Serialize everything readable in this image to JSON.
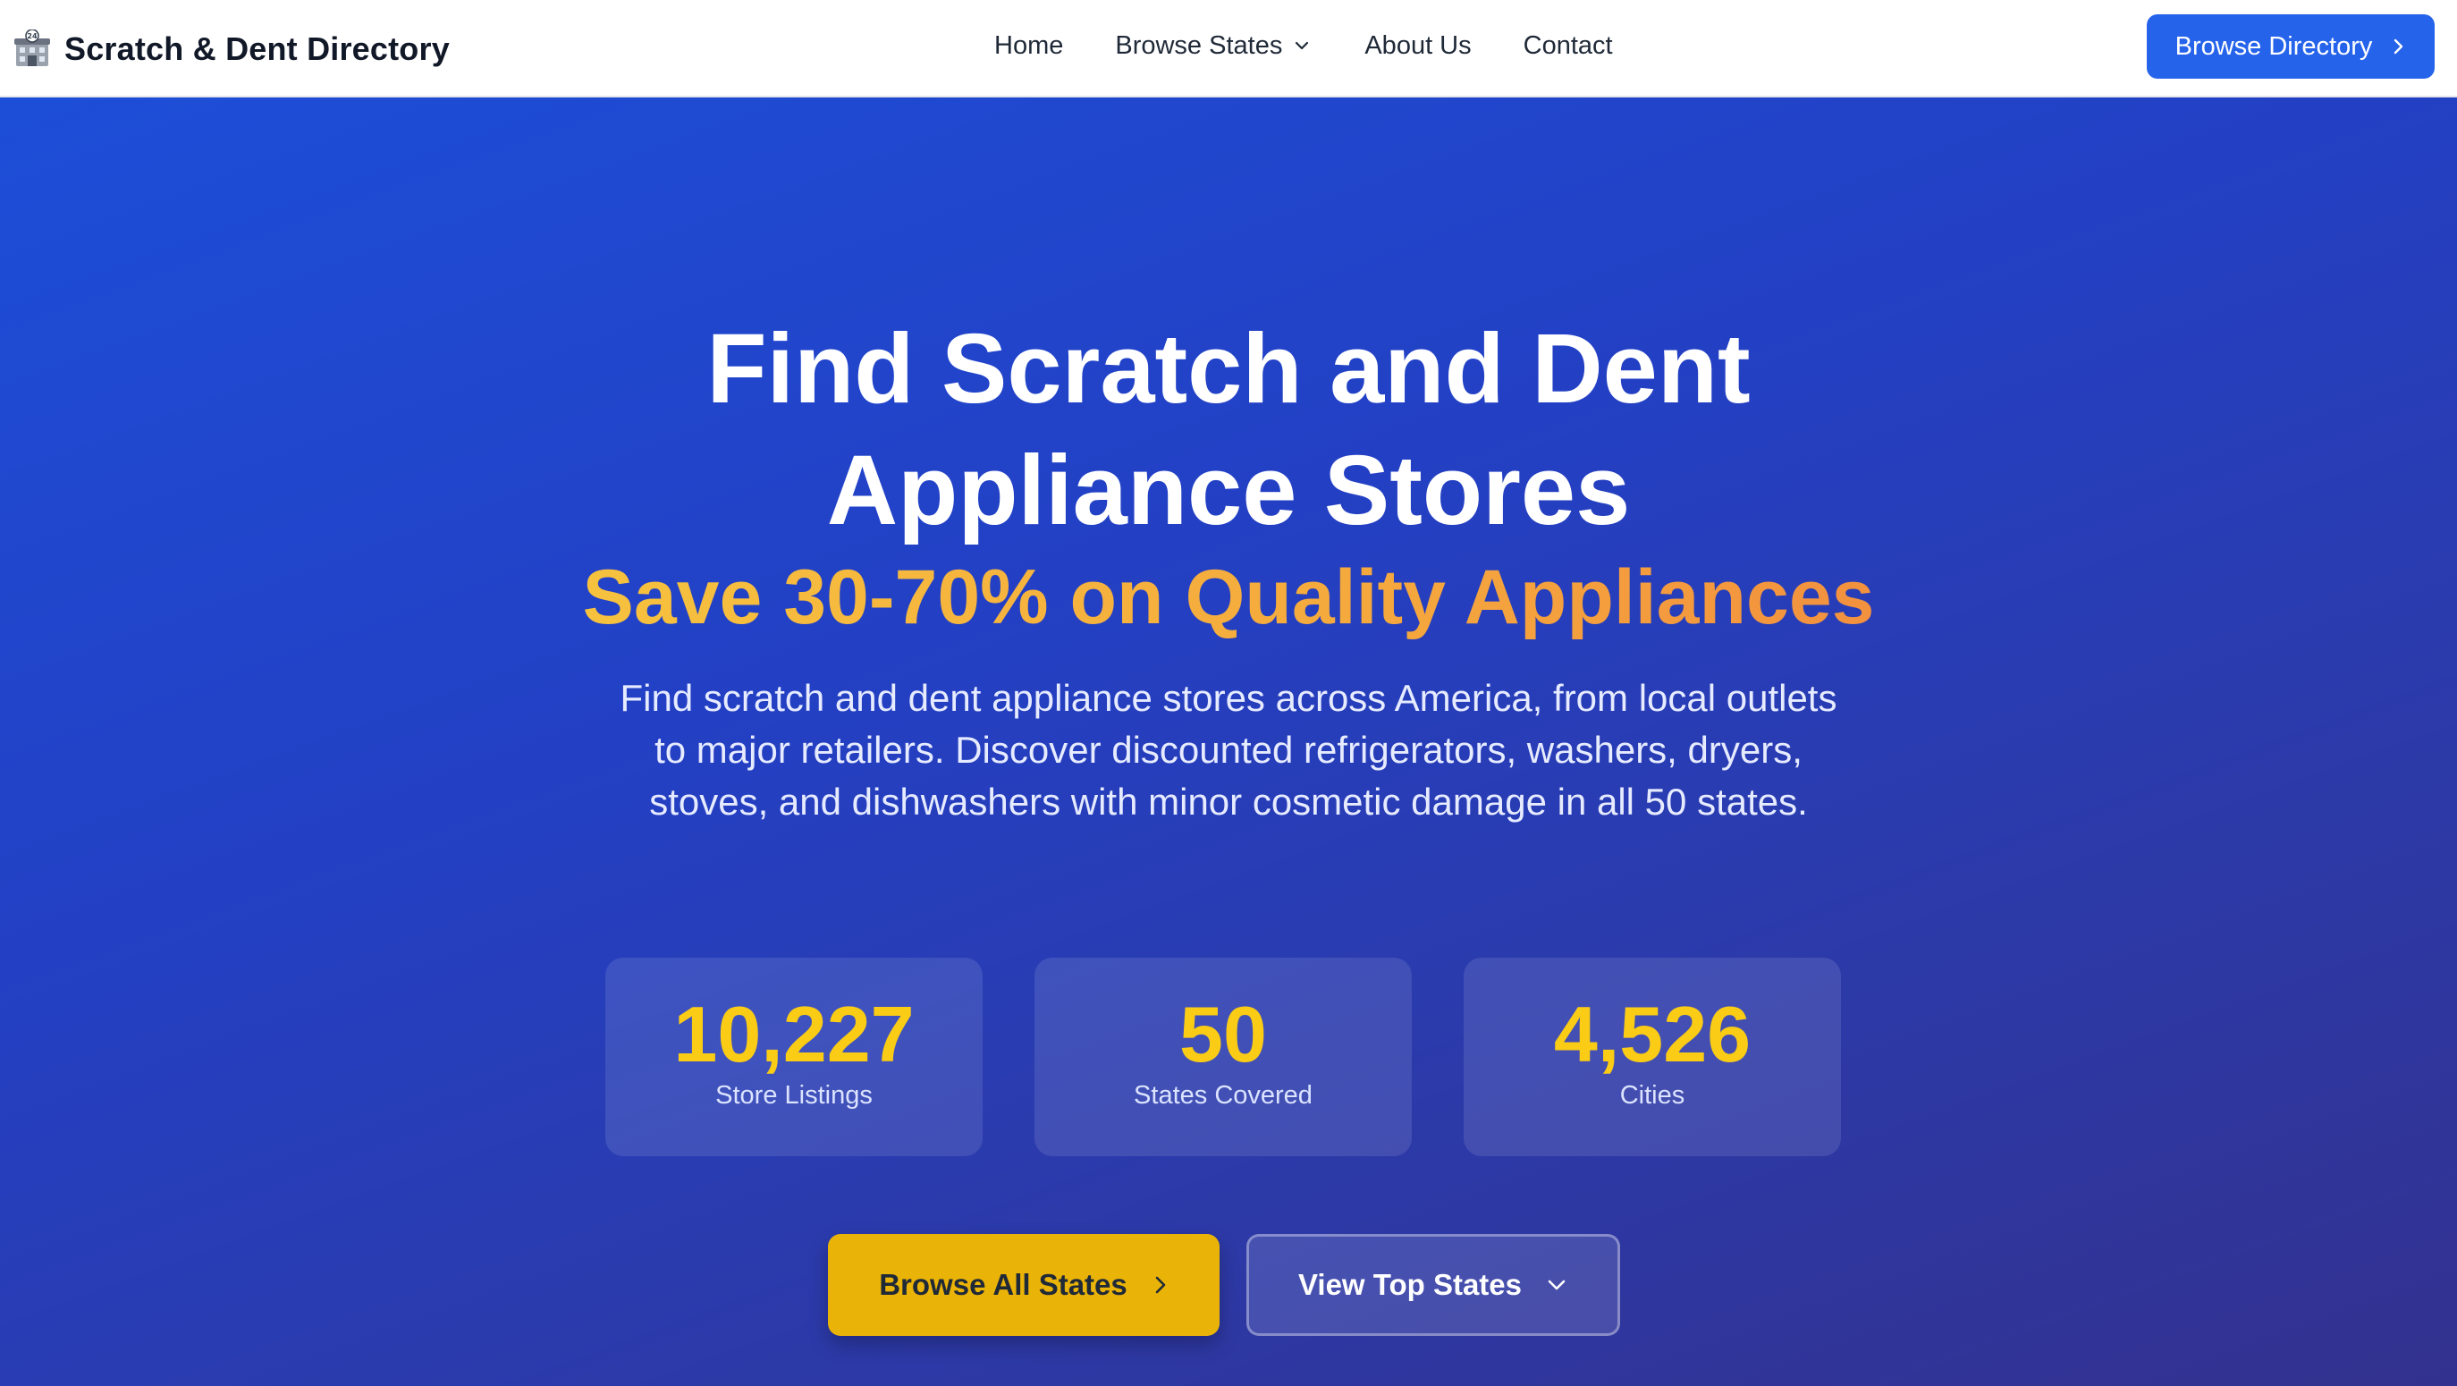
{
  "header": {
    "brand_name": "Scratch & Dent Directory",
    "brand_icon": "store-building-icon",
    "nav": {
      "home": "Home",
      "browse_states": "Browse States",
      "about": "About Us",
      "contact": "Contact"
    },
    "cta_label": "Browse Directory"
  },
  "hero": {
    "title_line1": "Find Scratch and Dent",
    "title_line2": "Appliance Stores",
    "subtitle": "Save 30-70% on Quality Appliances",
    "description": "Find scratch and dent appliance stores across America, from local outlets to major retailers. Discover discounted refrigerators, washers, dryers, stoves, and dishwashers with minor cosmetic damage in all 50 states.",
    "stats": [
      {
        "value": "10,227",
        "label": "Store Listings"
      },
      {
        "value": "50",
        "label": "States Covered"
      },
      {
        "value": "4,526",
        "label": "Cities"
      }
    ],
    "primary_button": "Browse All States",
    "secondary_button": "View Top States"
  },
  "colors": {
    "nav_cta": "#2563eb",
    "hero_gradient_start": "#1d4ed8",
    "hero_gradient_end": "#33318f",
    "stat_value": "#facc15",
    "primary_button": "#eab308",
    "subtitle_gradient": [
      "#f6c23e",
      "#f2913f"
    ]
  }
}
